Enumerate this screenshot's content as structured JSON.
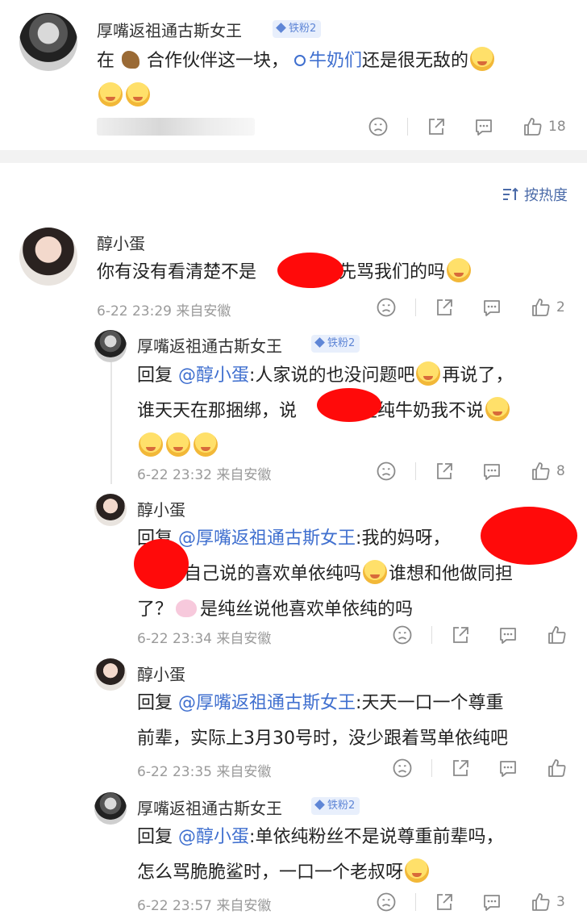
{
  "post": {
    "author": "厚嘴返祖通古斯女王",
    "badge": "铁粉2",
    "text_prefix": "在",
    "text_mid": "合作伙伴这一块，",
    "topic": "牛奶们",
    "text_suffix": "还是很无敌的",
    "likes": "18"
  },
  "sort": {
    "label": "按热度"
  },
  "comments": [
    {
      "author": "醇小蛋",
      "text_a": "你有没有看清楚不是",
      "text_b": "家先骂我们的吗",
      "time": "6-22 23:29 来自安徽",
      "likes": "2"
    }
  ],
  "replies": [
    {
      "author": "厚嘴返祖通古斯女王",
      "badge": "铁粉2",
      "reply_prefix": "回复",
      "mention": "@醇小蛋",
      "line1": ":人家说的也没问题吧",
      "line1b": "再说了，",
      "line2a": "谁天天在那捆绑，说",
      "line2b": "是纯牛奶我不说",
      "time": "6-22 23:32 来自安徽",
      "likes": "8"
    },
    {
      "author": "醇小蛋",
      "reply_prefix": "回复",
      "mention": "@厚嘴返祖通古斯女王",
      "line1": ":我的妈呀，",
      "line2": "自己说的喜欢单依纯吗",
      "line2b": "谁想和他做同担",
      "line3a": "了？",
      "line3b": "是纯丝说他喜欢单依纯的吗",
      "time": "6-22 23:34 来自安徽",
      "likes": ""
    },
    {
      "author": "醇小蛋",
      "reply_prefix": "回复",
      "mention": "@厚嘴返祖通古斯女王",
      "line1": ":天天一口一个尊重",
      "line2": "前辈，实际上3月30号时，没少跟着骂单依纯吧",
      "time": "6-22 23:35 来自安徽",
      "likes": ""
    },
    {
      "author": "厚嘴返祖通古斯女王",
      "badge": "铁粉2",
      "reply_prefix": "回复",
      "mention": "@醇小蛋",
      "line1": ":单依纯粉丝不是说尊重前辈吗，",
      "line2": "怎么骂脆脆鲨时，一口一个老叔呀",
      "time": "6-22 23:57 来自安徽",
      "likes": "3"
    }
  ],
  "colors": {
    "accent": "#3f6fcf",
    "badge_bg": "#e8effc",
    "redact": "#ff0a0a"
  },
  "icons": [
    "dislike-icon",
    "share-icon",
    "comment-icon",
    "like-icon",
    "sort-icon",
    "search-icon"
  ]
}
